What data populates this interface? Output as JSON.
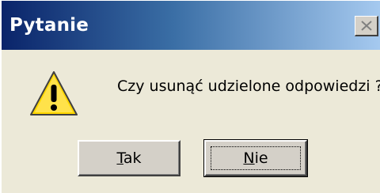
{
  "window": {
    "title": "Pytanie",
    "close_icon": "close-icon"
  },
  "dialog": {
    "icon": "warning-icon",
    "message": "Czy usunąć udzielone odpowiedzi ?"
  },
  "buttons": {
    "yes": {
      "accel": "T",
      "rest": "ak"
    },
    "no": {
      "accel": "N",
      "rest": "ie"
    }
  },
  "colors": {
    "titlebar_start": "#0a246a",
    "titlebar_end": "#a6caf0",
    "dialog_bg": "#ece9d8",
    "warning_fill": "#ffd700"
  }
}
